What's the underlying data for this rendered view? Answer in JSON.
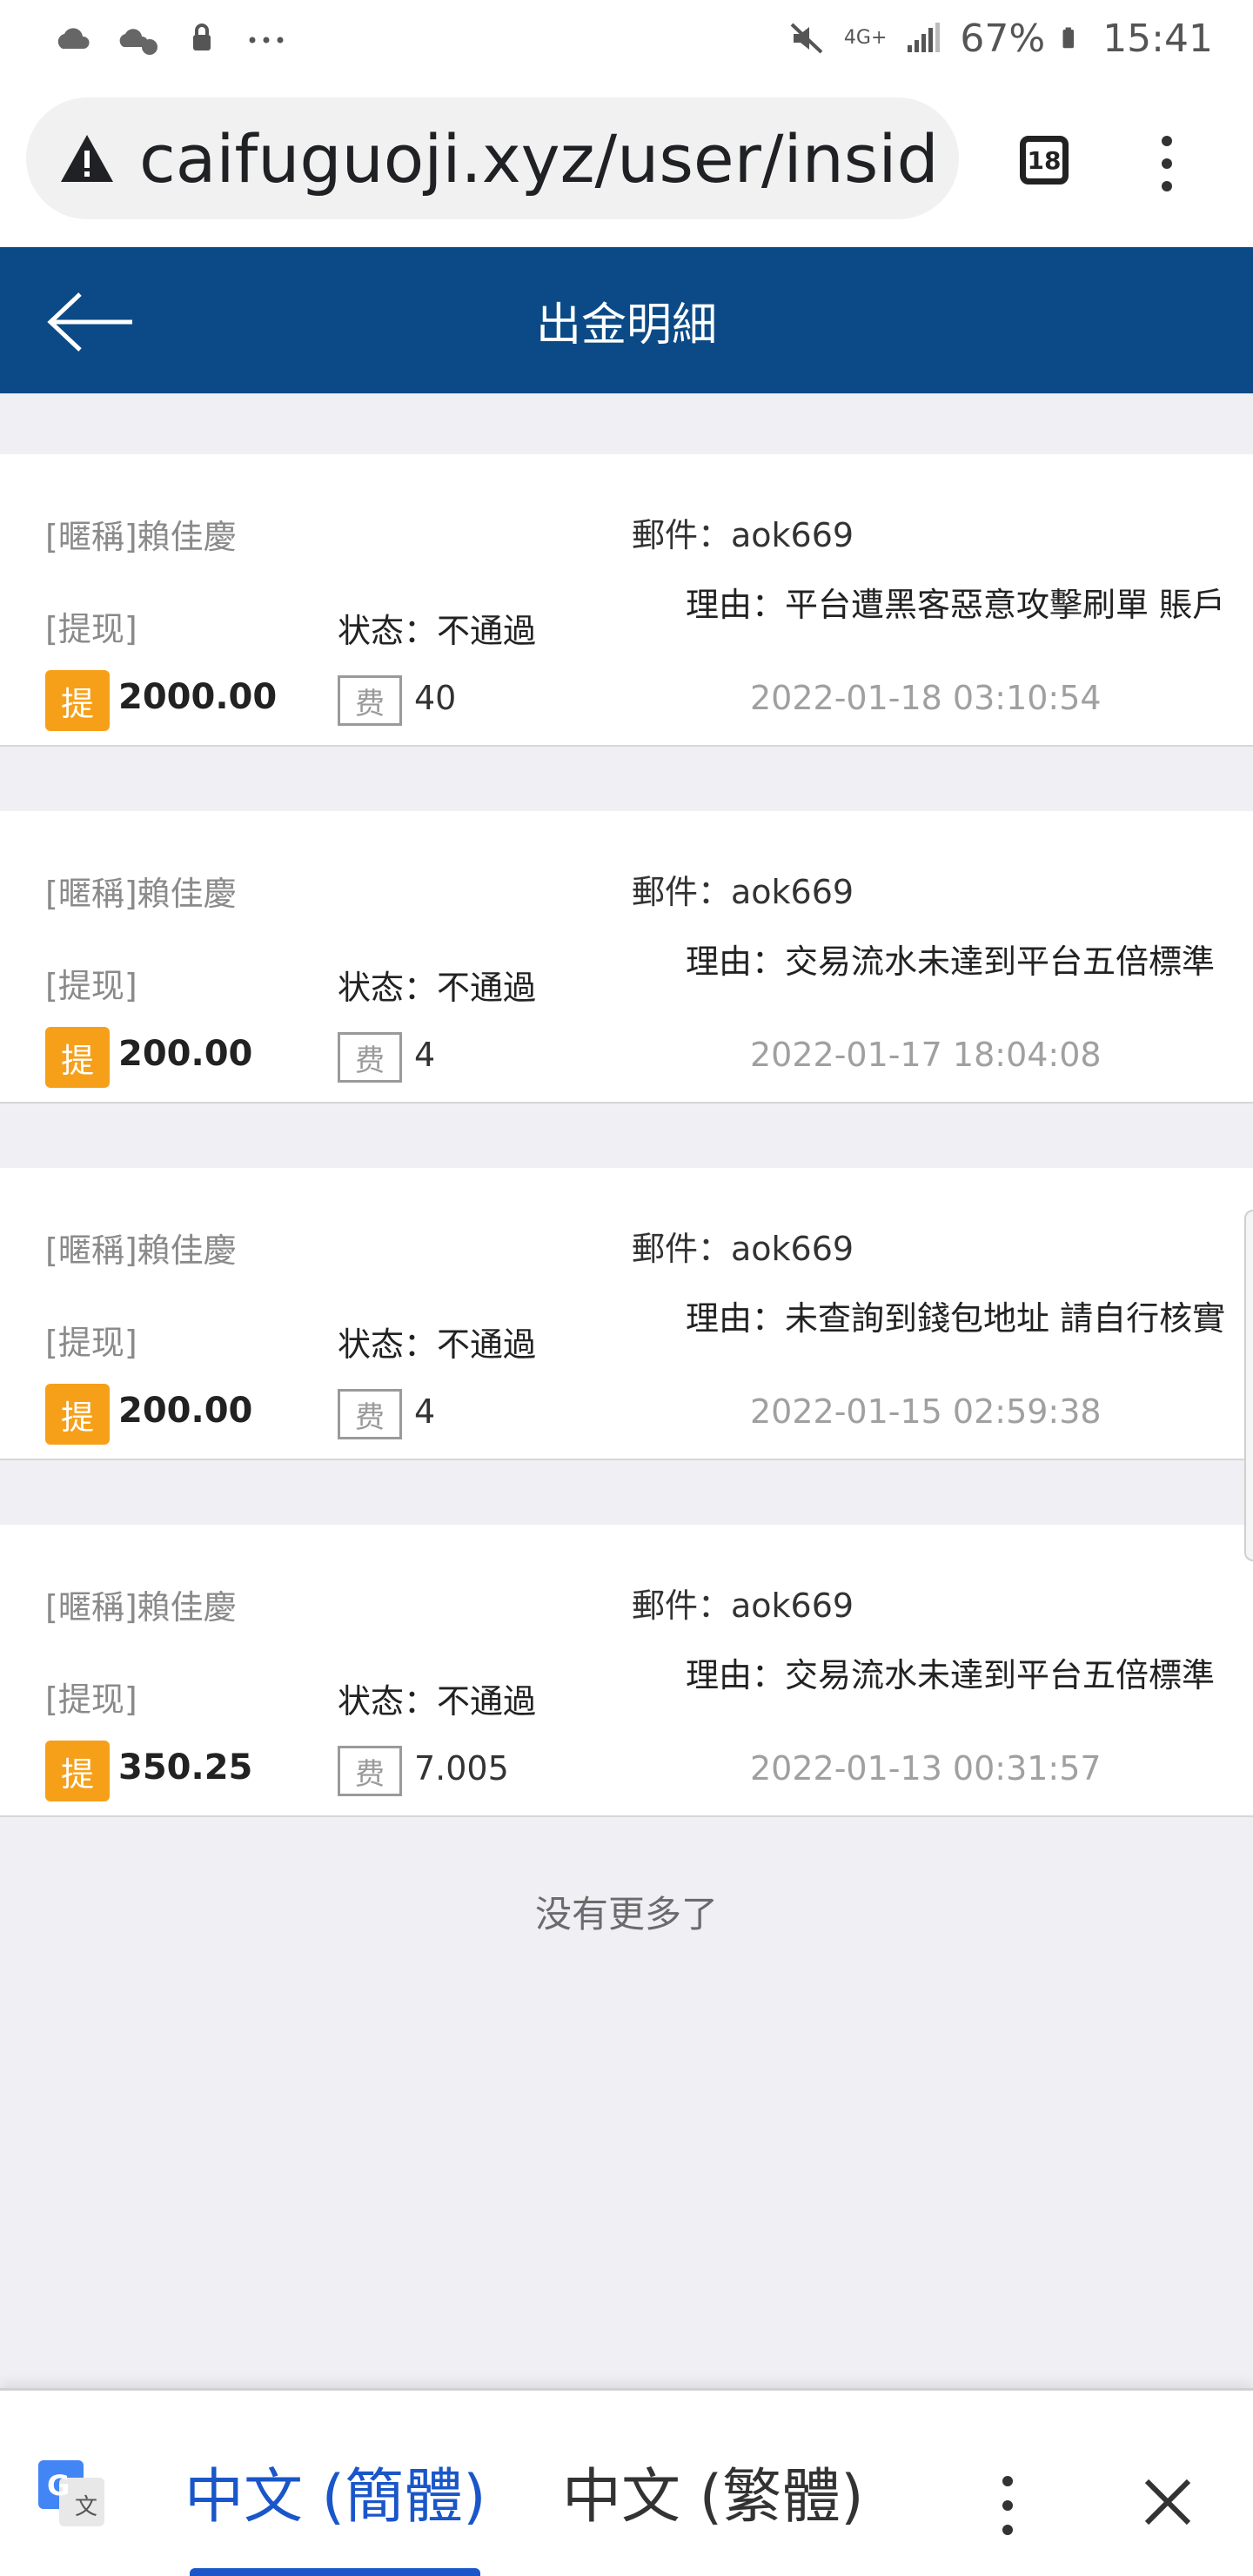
{
  "status_bar": {
    "battery": "67%",
    "time": "15:41",
    "network": "4G+"
  },
  "browser": {
    "url": "caifuguoji.xyz/user/insid",
    "tab_count": "18"
  },
  "header": {
    "title": "出金明細"
  },
  "records": [
    {
      "nickname": "[暱稱]賴佳慶",
      "email": "郵件：aok669",
      "reason": "理由：平台遭黑客惡意攻擊刷單 賬戶",
      "type": "[提现]",
      "status": "状态：不通過",
      "tag": "提",
      "amount": "2000.00",
      "fee_label": "费",
      "fee": "40",
      "time": "2022-01-18 03:10:54"
    },
    {
      "nickname": "[暱稱]賴佳慶",
      "email": "郵件：aok669",
      "reason": "理由：交易流水未達到平台五倍標準",
      "type": "[提现]",
      "status": "状态：不通過",
      "tag": "提",
      "amount": "200.00",
      "fee_label": "费",
      "fee": "4",
      "time": "2022-01-17 18:04:08"
    },
    {
      "nickname": "[暱稱]賴佳慶",
      "email": "郵件：aok669",
      "reason": "理由：未查詢到錢包地址 請自行核實",
      "type": "[提现]",
      "status": "状态：不通過",
      "tag": "提",
      "amount": "200.00",
      "fee_label": "费",
      "fee": "4",
      "time": "2022-01-15 02:59:38"
    },
    {
      "nickname": "[暱稱]賴佳慶",
      "email": "郵件：aok669",
      "reason": "理由：交易流水未達到平台五倍標準",
      "type": "[提现]",
      "status": "状态：不通過",
      "tag": "提",
      "amount": "350.25",
      "fee_label": "费",
      "fee": "7.005",
      "time": "2022-01-13 00:31:57"
    }
  ],
  "footer_text": "没有更多了",
  "translate_bar": {
    "lang_simplified": "中文 (簡體)",
    "lang_traditional": "中文 (繁體)"
  },
  "colors": {
    "header_bg": "#0b4a86",
    "tag_bg": "#f6a01a",
    "active_lang": "#1a56c9"
  }
}
